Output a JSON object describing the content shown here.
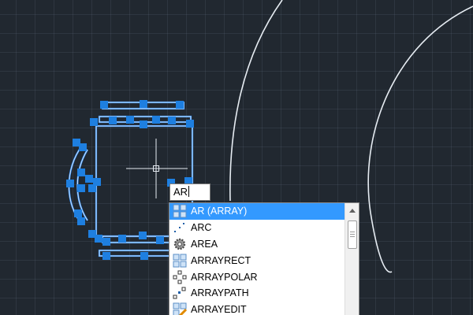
{
  "command_line": {
    "typed_value": "AR"
  },
  "autocomplete": {
    "items": [
      {
        "label": "AR (ARRAY)",
        "icon": "array-icon",
        "selected": true
      },
      {
        "label": "ARC",
        "icon": "arc-icon",
        "selected": false
      },
      {
        "label": "AREA",
        "icon": "area-gear-icon",
        "selected": false
      },
      {
        "label": "ARRAYRECT",
        "icon": "array-rect-icon",
        "selected": false
      },
      {
        "label": "ARRAYPOLAR",
        "icon": "array-polar-icon",
        "selected": false
      },
      {
        "label": "ARRAYPATH",
        "icon": "array-path-icon",
        "selected": false
      },
      {
        "label": "ARRAYEDIT",
        "icon": "array-edit-icon",
        "selected": false
      }
    ]
  },
  "colors": {
    "canvas_background": "#212830",
    "selection_grip": "#1e7fe0",
    "selected_item": "#3399ff",
    "geometry_line": "#e6ecf2"
  }
}
